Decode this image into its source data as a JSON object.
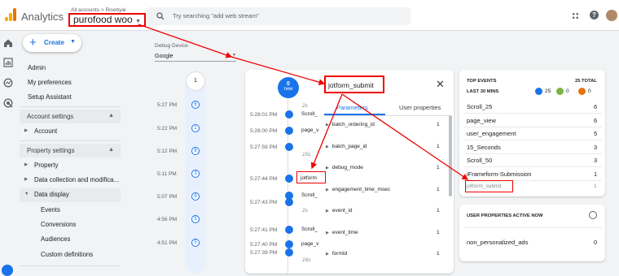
{
  "app": {
    "title": "Analytics"
  },
  "account": {
    "breadcrumb": "All accounts > Risebyai",
    "property": "purofood woo"
  },
  "search": {
    "placeholder": "Try searching \"add web stream\""
  },
  "create": {
    "label": "Create"
  },
  "nav": {
    "admin": "Admin",
    "preferences": "My preferences",
    "setup": "Setup Assistant",
    "account_settings": "Account settings",
    "account": "Account",
    "property_settings": "Property settings",
    "property": "Property",
    "data_collection": "Data collection and modifica...",
    "data_display": "Data display",
    "events": "Events",
    "conversions": "Conversions",
    "audiences": "Audiences",
    "custom_definitions": "Custom definitions"
  },
  "debug": {
    "label": "Debug Device",
    "device": "Google"
  },
  "minutes_timeline": [
    {
      "time": "",
      "count": "1"
    },
    {
      "time": "5:27 PM",
      "count": "6"
    },
    {
      "time": "5:22 PM",
      "count": "1"
    },
    {
      "time": "5:12 PM",
      "count": "8"
    },
    {
      "time": "5:11 PM",
      "count": "3"
    },
    {
      "time": "5:07 PM",
      "count": "6"
    },
    {
      "time": "4:56 PM",
      "count": "5"
    },
    {
      "time": "4:51 PM",
      "count": "5"
    }
  ],
  "stream": {
    "new_count": "0",
    "new_label": "new",
    "items": [
      {
        "time": "",
        "label": "2s",
        "kind": "duration"
      },
      {
        "time": "5:28:01 PM",
        "label": "Scroll_",
        "kind": "event"
      },
      {
        "time": "5:28:00 PM",
        "label": "page_v",
        "kind": "event"
      },
      {
        "time": "5:27:59 PM",
        "label": "",
        "kind": "event"
      },
      {
        "time": "",
        "label": "15s",
        "kind": "duration"
      },
      {
        "time": "5:27:44 PM",
        "label": "jotform",
        "kind": "event"
      },
      {
        "time": "",
        "label": "Scroll_",
        "kind": "event"
      },
      {
        "time": "5:27:43 PM",
        "label": "",
        "kind": "event"
      },
      {
        "time": "",
        "label": "2s",
        "kind": "duration"
      },
      {
        "time": "5:27:41 PM",
        "label": "Scroll_",
        "kind": "event"
      },
      {
        "time": "5:27:40 PM",
        "label": "page_v",
        "kind": "event"
      },
      {
        "time": "5:27:39 PM",
        "label": "",
        "kind": "event"
      },
      {
        "time": "",
        "label": "16s",
        "kind": "duration"
      }
    ]
  },
  "event_panel": {
    "title": "jotform_submit",
    "tab_params": "Parameters",
    "tab_user": "User properties",
    "params": [
      {
        "name": "batch_ordering_id",
        "count": "1"
      },
      {
        "name": "batch_page_id",
        "count": "1"
      },
      {
        "name": "debug_mode",
        "count": "1"
      },
      {
        "name": "engagement_time_msec",
        "count": "1"
      },
      {
        "name": "event_id",
        "count": "1"
      },
      {
        "name": "event_time",
        "count": "1"
      },
      {
        "name": "formId",
        "count": "1"
      }
    ]
  },
  "top_events": {
    "title": "TOP EVENTS",
    "total": "25 TOTAL",
    "subtitle": "LAST 30 MINS",
    "badges": [
      {
        "count": "25",
        "color": "#1a73e8"
      },
      {
        "count": "0",
        "color": "#7cb342"
      },
      {
        "count": "0",
        "color": "#e8710a"
      }
    ],
    "items": [
      {
        "name": "Scroll_25",
        "count": "6"
      },
      {
        "name": "page_view",
        "count": "6"
      },
      {
        "name": "user_engagement",
        "count": "5"
      },
      {
        "name": "15_Seconds",
        "count": "3"
      },
      {
        "name": "Scroll_50",
        "count": "3"
      },
      {
        "name": "iFrameform-Submission",
        "count": "1"
      },
      {
        "name": "jotform_submit",
        "count": "1"
      }
    ]
  },
  "user_props": {
    "title": "USER PROPERTIES ACTIVE NOW",
    "items": [
      {
        "name": "non_personalized_ads",
        "count": "0"
      }
    ]
  },
  "colors": {
    "accent": "#1a73e8",
    "highlight": "#e00000"
  }
}
